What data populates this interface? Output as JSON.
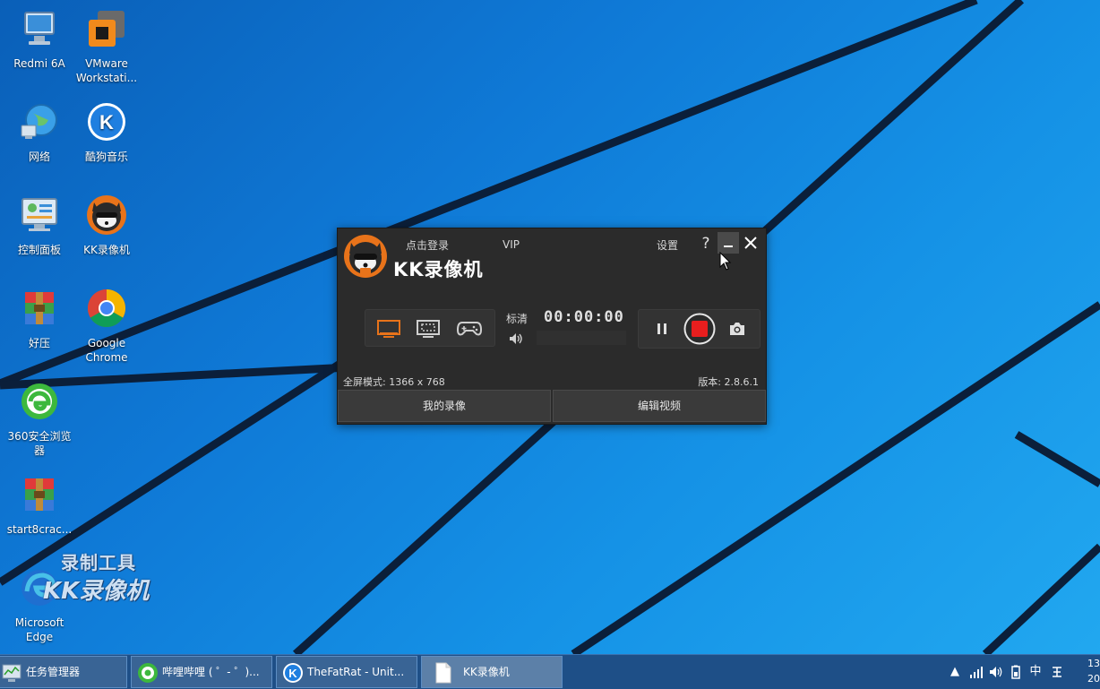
{
  "desktop": {
    "icons": [
      {
        "label": "Redmi 6A"
      },
      {
        "label": "VMware Workstati..."
      },
      {
        "label": "网络"
      },
      {
        "label": "酷狗音乐"
      },
      {
        "label": "控制面板"
      },
      {
        "label": "KK录像机"
      },
      {
        "label": "好压"
      },
      {
        "label": "Google Chrome"
      },
      {
        "label": "360安全浏览器"
      },
      {
        "label": "start8crac..."
      },
      {
        "label": "Microsoft Edge"
      }
    ],
    "watermark": {
      "line1": "录制工具",
      "line2": "KK录像机"
    }
  },
  "kk_window": {
    "title": "KK录像机",
    "login": "点击登录",
    "vip": "VIP",
    "settings": "设置",
    "help": "?",
    "quality": "标清",
    "timer": "00:00:00",
    "fullscreen_info": "全屏模式: 1366 x 768",
    "version": "版本: 2.8.6.1",
    "my_recordings": "我的录像",
    "edit_video": "编辑视频",
    "accent_color": "#e8731a",
    "record_color": "#e81e1e"
  },
  "taskbar": {
    "items": [
      {
        "label": "任务管理器"
      },
      {
        "label": "哔哩哔哩 ( ゜- ゜)..."
      },
      {
        "label": "TheFatRat - Unit..."
      },
      {
        "label": "KK录像机"
      }
    ],
    "tray": {
      "ime": "中",
      "clock": "13 20"
    }
  }
}
